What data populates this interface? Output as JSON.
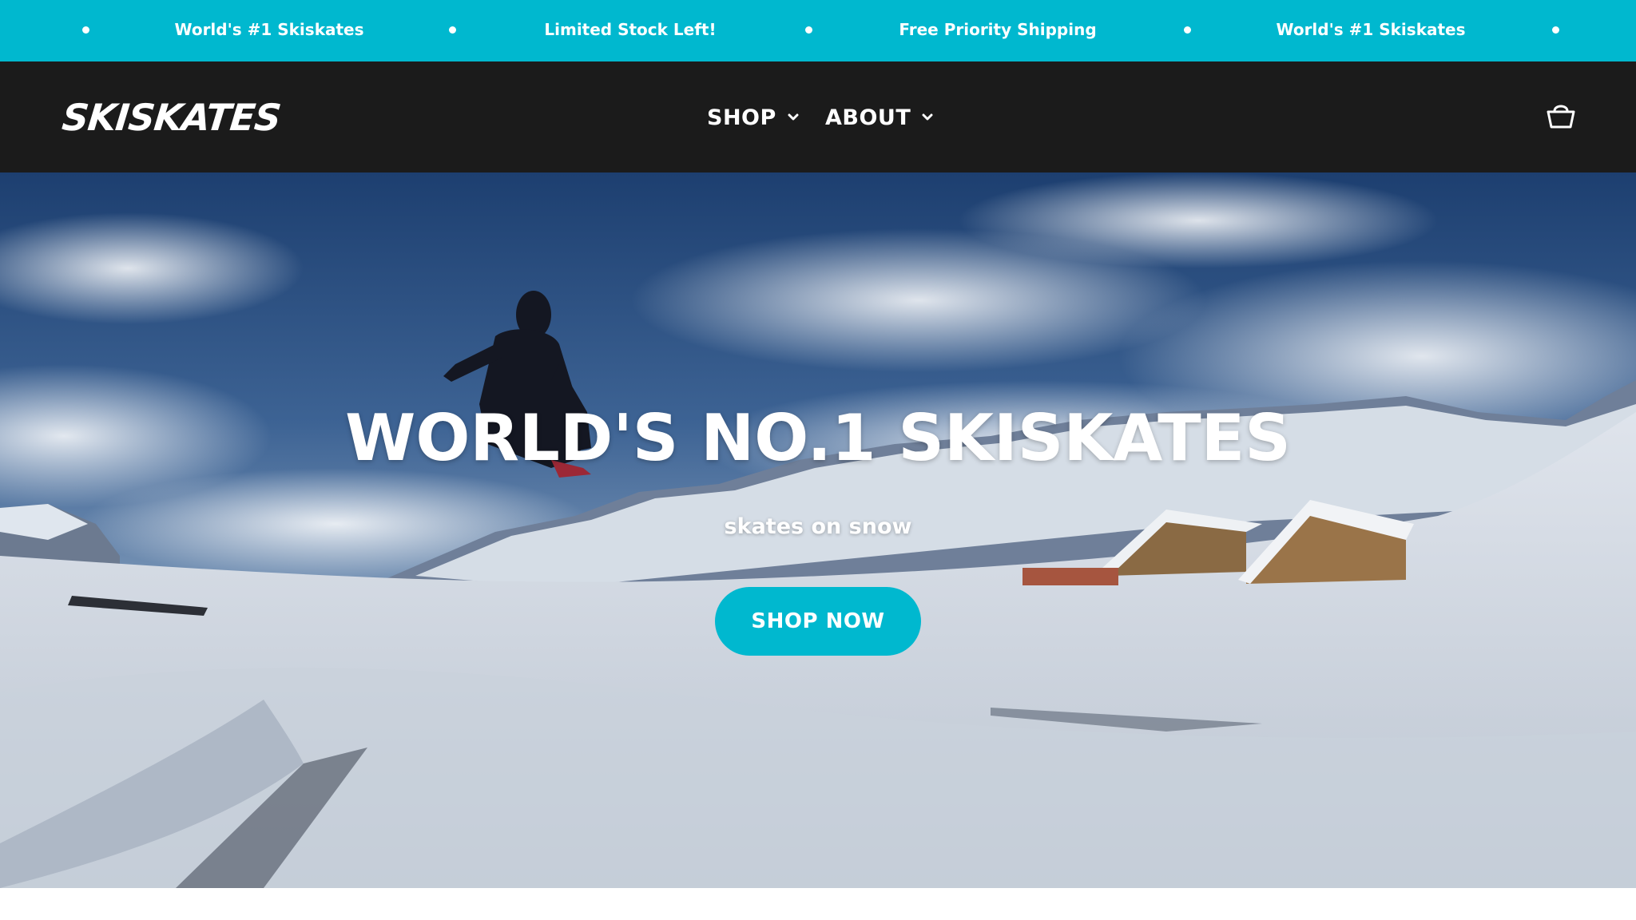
{
  "announcement_bar": {
    "background_color": "#00b8cf",
    "messages": [
      "World's #1 Skiskates",
      "Limited Stock Left!",
      "Free Priority Shipping",
      "World's #1 Skiskates"
    ]
  },
  "header": {
    "background_color": "#1b1b1b",
    "logo_text": "SKISKATES",
    "nav": [
      {
        "label": "SHOP",
        "icon": "chevron-down-icon"
      },
      {
        "label": "ABOUT",
        "icon": "chevron-down-icon"
      }
    ],
    "cart_icon": "basket-icon"
  },
  "hero": {
    "title": "WORLD'S NO.1 SKISKATES",
    "subtitle": "skates on snow",
    "cta_label": "SHOP NOW",
    "cta_color": "#00b8cf",
    "background": "snowy-mountain-skier-photo"
  }
}
